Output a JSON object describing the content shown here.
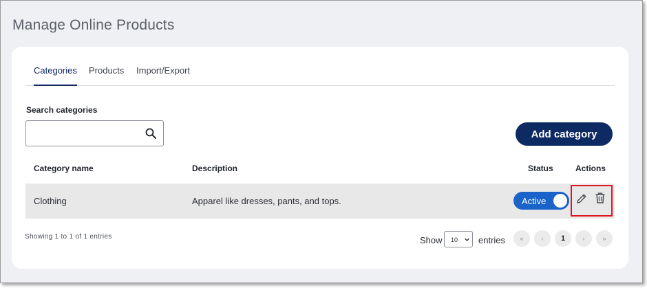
{
  "page": {
    "title": "Manage Online Products"
  },
  "tabs": [
    {
      "label": "Categories",
      "active": true
    },
    {
      "label": "Products",
      "active": false
    },
    {
      "label": "Import/Export",
      "active": false
    }
  ],
  "search": {
    "label": "Search categories",
    "value": "",
    "placeholder": "",
    "icon": "search-icon"
  },
  "add_button": {
    "label": "Add category"
  },
  "table": {
    "columns": [
      "Category name",
      "Description",
      "Status",
      "Actions"
    ],
    "rows": [
      {
        "name": "Clothing",
        "description": "Apparel like dresses, pants, and tops.",
        "status": "Active",
        "status_on": true,
        "actions": [
          "pencil-icon",
          "trash-icon"
        ]
      }
    ]
  },
  "footer": {
    "info": "Showing 1 to 1 of 1 entries",
    "show_label": "Show",
    "page_size": "10",
    "entries_label": "entries",
    "pagination": {
      "first": "«",
      "prev": "‹",
      "current": "1",
      "next": "›",
      "last": "»"
    }
  },
  "colors": {
    "primary": "#0e2a63",
    "toggle": "#1a63c9",
    "highlight": "#e0141e",
    "row_bg": "#e8e8e9",
    "page_bg": "#eef0f4"
  }
}
